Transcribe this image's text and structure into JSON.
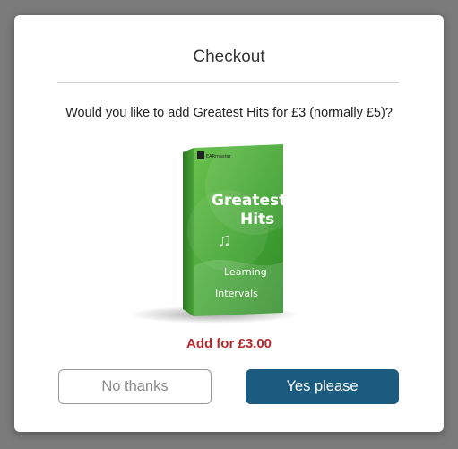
{
  "dialog": {
    "title": "Checkout",
    "question": "Would you like to add Greatest Hits for £3 (normally £5)?"
  },
  "product": {
    "cover_title_line1": "Greatest",
    "cover_title_line2": "Hits",
    "cover_subtitle_line1": "Learning",
    "cover_subtitle_line2": "Intervals",
    "publisher_mark": "EARmaster",
    "icon": "music-note-icon"
  },
  "offer": {
    "price_label": "Add for £3.00"
  },
  "buttons": {
    "decline_label": "No thanks",
    "accept_label": "Yes please"
  },
  "colors": {
    "accent_price": "#b8292f",
    "primary_button": "#1c5b80",
    "cover_green": "#4fae3a"
  }
}
